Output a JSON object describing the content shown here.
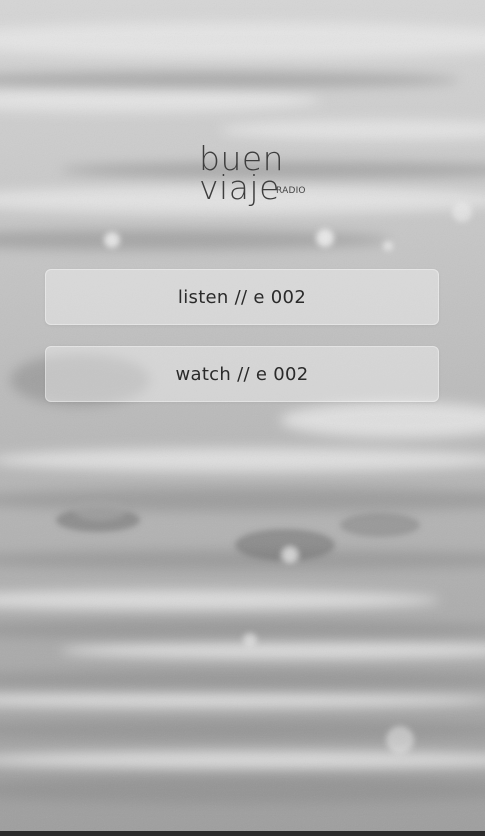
{
  "logo": {
    "line1": "buen",
    "line2": "viaje",
    "tag": "RADIO"
  },
  "buttons": {
    "listen": "listen // e 002",
    "watch": "watch // e 002"
  },
  "background": {
    "description_icon": "water-ripples-background"
  }
}
